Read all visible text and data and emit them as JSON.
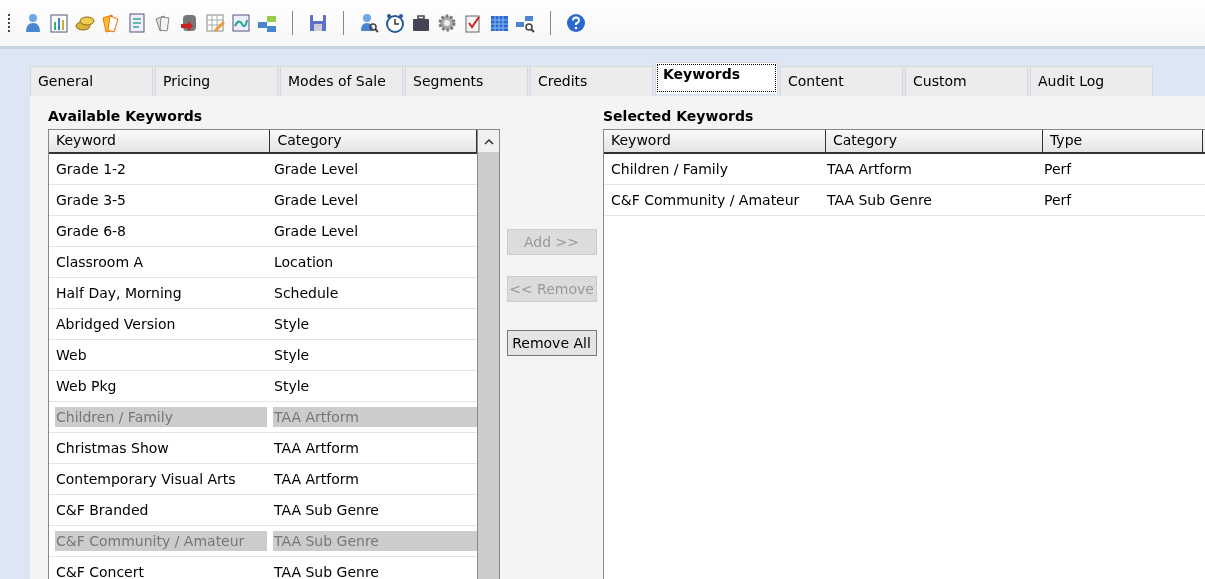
{
  "tabs": [
    {
      "label": "General",
      "selected": false
    },
    {
      "label": "Pricing",
      "selected": false
    },
    {
      "label": "Modes of Sale",
      "selected": false
    },
    {
      "label": "Segments",
      "selected": false
    },
    {
      "label": "Credits",
      "selected": false
    },
    {
      "label": "Keywords",
      "selected": true
    },
    {
      "label": "Content",
      "selected": false
    },
    {
      "label": "Custom",
      "selected": false
    },
    {
      "label": "Audit Log",
      "selected": false
    }
  ],
  "available": {
    "title": "Available Keywords",
    "columns": [
      "Keyword",
      "Category"
    ],
    "rows": [
      {
        "cells": [
          "Grade 1-2",
          "Grade Level"
        ],
        "disabled": false
      },
      {
        "cells": [
          "Grade 3-5",
          "Grade Level"
        ],
        "disabled": false
      },
      {
        "cells": [
          "Grade 6-8",
          "Grade Level"
        ],
        "disabled": false
      },
      {
        "cells": [
          "Classroom A",
          "Location"
        ],
        "disabled": false
      },
      {
        "cells": [
          "Half Day, Morning",
          "Schedule"
        ],
        "disabled": false
      },
      {
        "cells": [
          "Abridged Version",
          "Style"
        ],
        "disabled": false
      },
      {
        "cells": [
          "Web",
          "Style"
        ],
        "disabled": false
      },
      {
        "cells": [
          "Web Pkg",
          "Style"
        ],
        "disabled": false
      },
      {
        "cells": [
          "Children / Family",
          "TAA Artform"
        ],
        "disabled": true
      },
      {
        "cells": [
          "Christmas Show",
          "TAA Artform"
        ],
        "disabled": false
      },
      {
        "cells": [
          "Contemporary Visual Arts",
          "TAA Artform"
        ],
        "disabled": false
      },
      {
        "cells": [
          "C&F Branded",
          "TAA Sub Genre"
        ],
        "disabled": false
      },
      {
        "cells": [
          "C&F Community / Amateur",
          "TAA Sub Genre"
        ],
        "disabled": true
      },
      {
        "cells": [
          "C&F Concert",
          "TAA Sub Genre"
        ],
        "disabled": false
      }
    ]
  },
  "buttons": [
    {
      "label": "Add >>",
      "disabled": true
    },
    {
      "label": "<< Remove",
      "disabled": true
    },
    {
      "label": "Remove All",
      "disabled": false
    }
  ],
  "selected": {
    "title": "Selected Keywords",
    "columns": [
      "Keyword",
      "Category",
      "Type"
    ],
    "rows": [
      {
        "cells": [
          "Children / Family",
          "TAA Artform",
          "Perf"
        ],
        "disabled": false
      },
      {
        "cells": [
          "C&F Community / Amateur",
          "TAA Sub Genre",
          "Perf"
        ],
        "disabled": false
      }
    ]
  }
}
